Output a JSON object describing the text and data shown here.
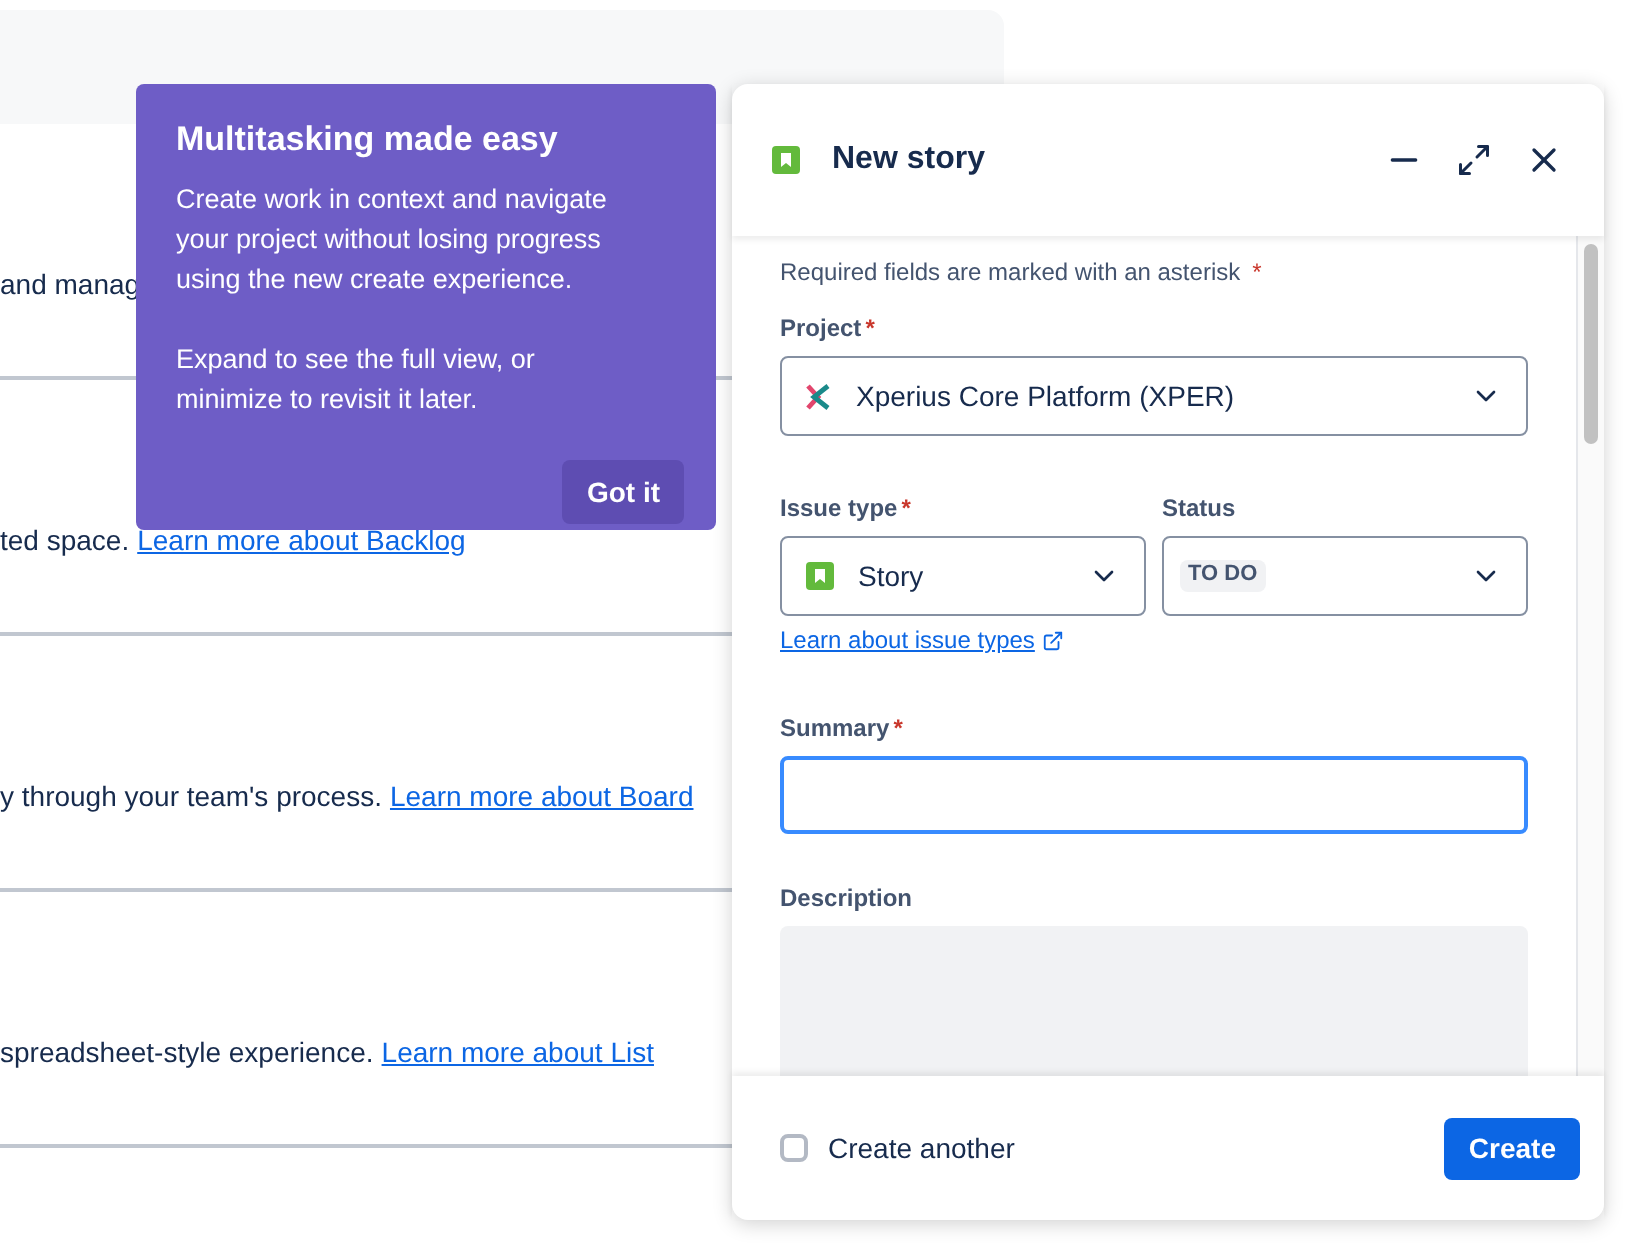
{
  "background_rows": [
    {
      "text": "and manag"
    },
    {
      "text": "ted space.",
      "link": "Learn more about Backlog"
    },
    {
      "text": "y through your team's process.",
      "link": "Learn more about Board"
    },
    {
      "text": "spreadsheet-style experience.",
      "link": "Learn more about List"
    }
  ],
  "tooltip": {
    "title": "Multitasking made easy",
    "paragraphs": [
      "Create work in context and navigate your project without losing progress using the new create experience.",
      "Expand to see the full view, or minimize to revisit it later."
    ],
    "button": "Got it"
  },
  "panel": {
    "title": "New story",
    "required_note": "Required fields are marked with an asterisk",
    "required_mark": "*",
    "project": {
      "label": "Project",
      "required": true,
      "value": "Xperius Core Platform (XPER)"
    },
    "issue_type": {
      "label": "Issue type",
      "required": true,
      "value": "Story"
    },
    "status": {
      "label": "Status",
      "required": false,
      "value": "TO DO"
    },
    "learn_link": "Learn about issue types",
    "summary": {
      "label": "Summary",
      "required": true,
      "focused": true
    },
    "description": {
      "label": "Description"
    },
    "create_another": {
      "label": "Create another",
      "checked": false
    },
    "create_button": "Create"
  }
}
